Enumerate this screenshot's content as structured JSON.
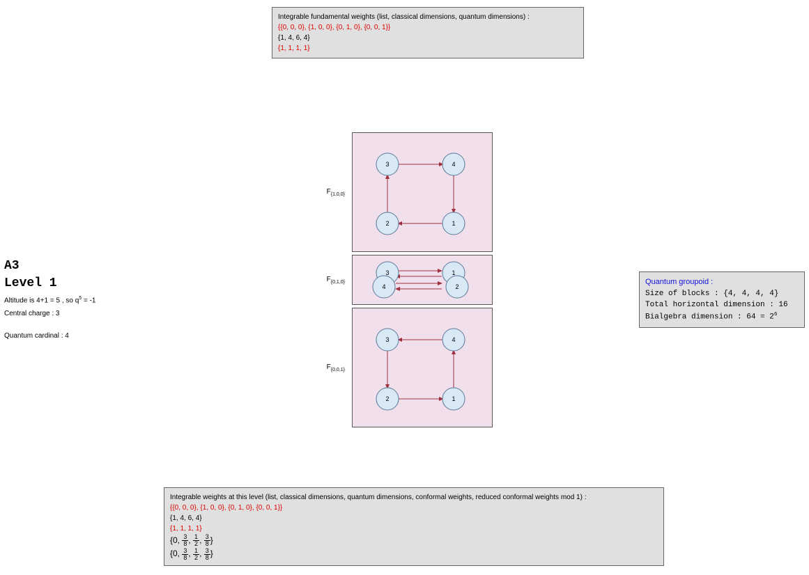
{
  "topBox": {
    "title": "Integrable fundamental weights (list, classical dimensions, quantum dimensions) :",
    "line1": "{{0, 0, 0}, {1, 0, 0}, {0, 1, 0}, {0, 0, 1}}",
    "line2": "{1, 4, 6, 4}",
    "line3": "{1, 1, 1, 1}"
  },
  "left": {
    "name": "A3",
    "level": "Level 1",
    "altitude_prefix": "Altitude is 4+1 = 5 , so q",
    "altitude_exp": "5",
    "altitude_suffix": " = -1",
    "centralCharge": "Central charge : 3",
    "qcard": "Quantum cardinal : 4"
  },
  "right": {
    "title": "Quantum groupoid :",
    "blocks": "Size of blocks : {4, 4, 4, 4}",
    "horiz": "Total horizontal dimension : 16",
    "bialg_prefix": "Bialgebra dimension : 64 = 2",
    "bialg_exp": "6"
  },
  "bottomBox": {
    "title": "Integrable weights at this level  (list, classical dimensions, quantum dimensions, conformal weights, reduced conformal weights mod 1) :",
    "line1": "{{0, 0, 0}, {1, 0, 0}, {0, 1, 0}, {0, 0, 1}}",
    "line2": "{1, 4, 6, 4}",
    "line3": "{1, 1, 1, 1}"
  },
  "graphs": {
    "g1": {
      "label": "{1,0,0}",
      "nodes": {
        "tl": "3",
        "tr": "4",
        "bl": "2",
        "br": "1"
      }
    },
    "g2": {
      "label": "{0,1,0}",
      "nodes": {
        "tl": "3",
        "tr": "1",
        "bl": "4",
        "br": "2"
      }
    },
    "g3": {
      "label": "{0,0,1}",
      "nodes": {
        "tl": "3",
        "tr": "4",
        "bl": "2",
        "br": "1"
      }
    }
  },
  "chart_data": {
    "type": "table",
    "lie_algebra": "A3",
    "level": 1,
    "altitude": 5,
    "q_power": 5,
    "q_value": -1,
    "central_charge": 3,
    "quantum_cardinal": 4,
    "integrable_fundamental_weights": [
      [
        0,
        0,
        0
      ],
      [
        1,
        0,
        0
      ],
      [
        0,
        1,
        0
      ],
      [
        0,
        0,
        1
      ]
    ],
    "classical_dimensions": [
      1,
      4,
      6,
      4
    ],
    "quantum_dimensions": [
      1,
      1,
      1,
      1
    ],
    "conformal_weights": [
      0,
      "3/8",
      "1/2",
      "3/8"
    ],
    "reduced_conformal_weights_mod_1": [
      0,
      "3/8",
      "1/2",
      "3/8"
    ],
    "quantum_groupoid": {
      "block_sizes": [
        4,
        4,
        4,
        4
      ],
      "total_horizontal_dimension": 16,
      "bialgebra_dimension": 64
    },
    "fusion_graphs": [
      {
        "weight": [
          1,
          0,
          0
        ],
        "vertices": [
          1,
          2,
          3,
          4
        ],
        "edges": [
          [
            1,
            4
          ],
          [
            4,
            3
          ],
          [
            3,
            2
          ],
          [
            2,
            1
          ]
        ]
      },
      {
        "weight": [
          0,
          1,
          0
        ],
        "vertices": [
          1,
          2,
          3,
          4
        ],
        "edges": [
          [
            3,
            1
          ],
          [
            1,
            3
          ],
          [
            4,
            2
          ],
          [
            2,
            4
          ]
        ]
      },
      {
        "weight": [
          0,
          0,
          1
        ],
        "vertices": [
          1,
          2,
          3,
          4
        ],
        "edges": [
          [
            1,
            2
          ],
          [
            2,
            3
          ],
          [
            3,
            4
          ],
          [
            4,
            1
          ]
        ]
      }
    ]
  }
}
